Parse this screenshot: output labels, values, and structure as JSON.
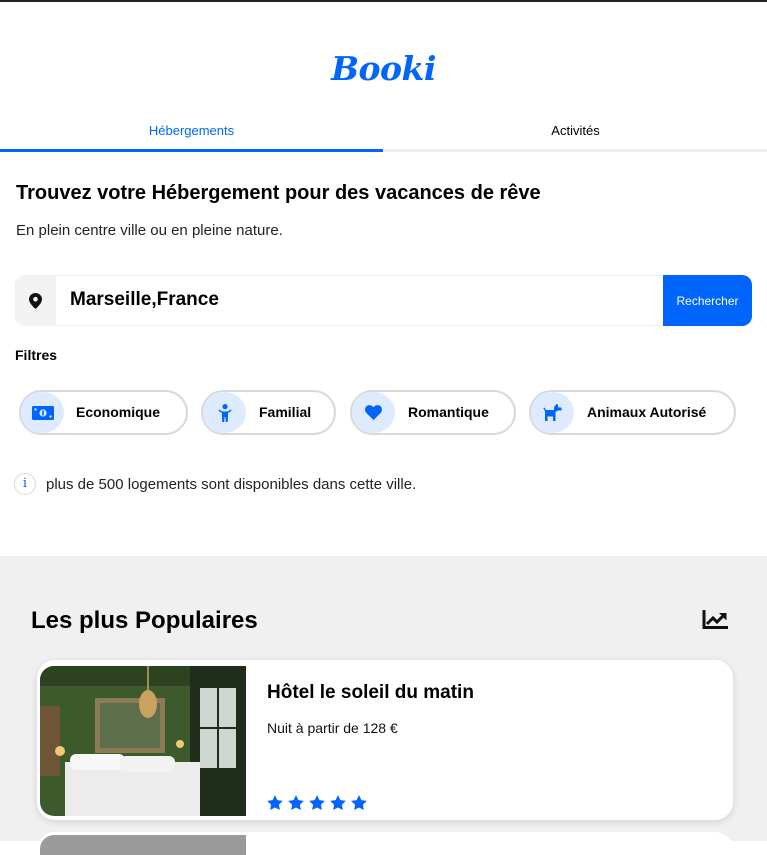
{
  "header": {
    "logo": "Booki"
  },
  "tabs": [
    {
      "label": "Hébergements",
      "active": true
    },
    {
      "label": "Activités",
      "active": false
    }
  ],
  "hero": {
    "title": "Trouvez votre Hébergement pour des vacances de rêve",
    "subtitle": "En plein centre ville ou en pleine nature."
  },
  "search": {
    "value": "Marseille,France",
    "button_label": "Rechercher",
    "icon": "map-pin-icon"
  },
  "filters": {
    "label": "Filtres",
    "items": [
      {
        "label": "Economique",
        "icon": "money-bill-icon"
      },
      {
        "label": "Familial",
        "icon": "child-icon"
      },
      {
        "label": "Romantique",
        "icon": "heart-icon"
      },
      {
        "label": "Animaux Autorisé",
        "icon": "dog-icon"
      }
    ]
  },
  "info": {
    "icon_glyph": "i",
    "text": "plus de 500 logements sont disponibles dans cette ville."
  },
  "popular": {
    "title": "Les plus Populaires",
    "icon": "trend-up-icon",
    "cards": [
      {
        "name": "Hôtel le soleil du matin",
        "price": "Nuit à partir de 128 €",
        "rating": 5
      }
    ]
  },
  "colors": {
    "accent": "#0065FC",
    "chip_bg": "#DEEBFF",
    "section_bg": "#F0F0F0"
  }
}
